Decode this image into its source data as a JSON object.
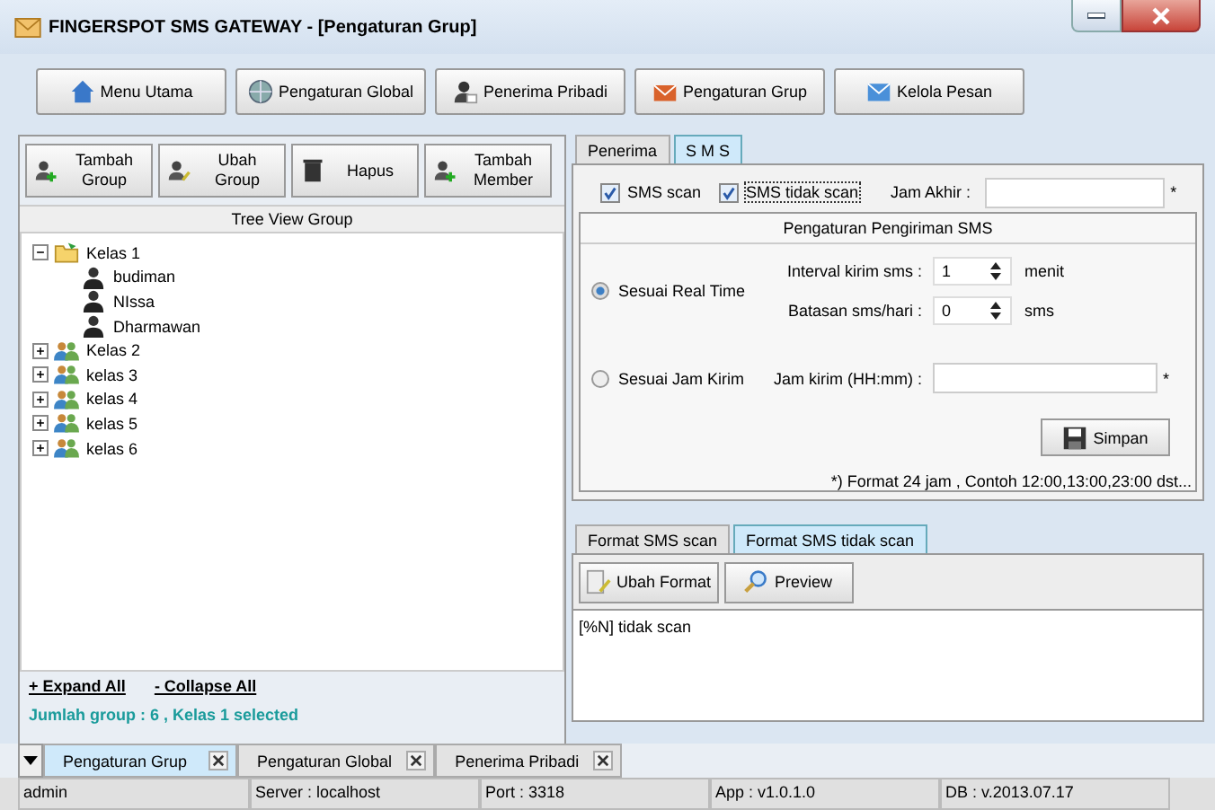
{
  "window": {
    "title": "FINGERSPOT SMS GATEWAY - [Pengaturan Grup]"
  },
  "toolbar": [
    {
      "label": "Menu Utama"
    },
    {
      "label": "Pengaturan Global"
    },
    {
      "label": "Penerima Pribadi"
    },
    {
      "label": "Pengaturan Grup"
    },
    {
      "label": "Kelola Pesan"
    }
  ],
  "left_panel": {
    "buttons": [
      {
        "label": "Tambah Group"
      },
      {
        "label": "Ubah Group"
      },
      {
        "label": "Hapus"
      },
      {
        "label": "Tambah Member"
      }
    ],
    "tree_title": "Tree View Group",
    "tree": [
      {
        "label": "Kelas 1",
        "expanded": true,
        "children": [
          {
            "label": "budiman"
          },
          {
            "label": "NIssa"
          },
          {
            "label": "Dharmawan"
          }
        ]
      },
      {
        "label": "Kelas 2",
        "expanded": false
      },
      {
        "label": "kelas 3",
        "expanded": false
      },
      {
        "label": "kelas 4",
        "expanded": false
      },
      {
        "label": "kelas 5",
        "expanded": false
      },
      {
        "label": "kelas 6",
        "expanded": false
      }
    ],
    "expand_all": "+ Expand All",
    "collapse_all": "- Collapse All",
    "status": "Jumlah group : 6 , Kelas 1 selected"
  },
  "right_panel": {
    "tabs": [
      {
        "label": "Penerima",
        "selected": false
      },
      {
        "label": "S M S",
        "selected": true
      }
    ],
    "checkboxes": [
      {
        "label": "SMS scan",
        "checked": true
      },
      {
        "label": "SMS tidak scan",
        "checked": true
      }
    ],
    "jam_akhir": {
      "label": "Jam Akhir :",
      "required": "*"
    },
    "group_title": "Pengaturan Pengiriman SMS",
    "real_time": {
      "label": "Sesuai Real Time",
      "selected": true
    },
    "interval": {
      "label": "Interval kirim sms :",
      "value": "1",
      "unit": "menit"
    },
    "batasan": {
      "label": "Batasan sms/hari :",
      "value": "0",
      "unit": "sms"
    },
    "jam_kirim_option": {
      "label": "Sesuai Jam Kirim",
      "selected": false
    },
    "jam_kirim": {
      "label": "Jam kirim (HH:mm) :",
      "required": "*"
    },
    "save_button": "Simpan",
    "note": "*) Format 24 jam , Contoh 12:00,13:00,23:00 dst...",
    "format_tabs": [
      {
        "label": "Format SMS scan",
        "selected": false
      },
      {
        "label": "Format SMS tidak scan",
        "selected": true
      }
    ],
    "format_buttons": [
      {
        "label": "Ubah Format"
      },
      {
        "label": "Preview"
      }
    ],
    "format_text": "[%N] tidak scan"
  },
  "document_tabs": [
    {
      "label": "Pengaturan Grup",
      "selected": true
    },
    {
      "label": "Pengaturan Global",
      "selected": false
    },
    {
      "label": "Penerima Pribadi",
      "selected": false
    }
  ],
  "status_bar": [
    "admin",
    "Server : localhost",
    "Port : 3318",
    "App : v1.0.1.0",
    "DB : v.2013.07.17"
  ]
}
